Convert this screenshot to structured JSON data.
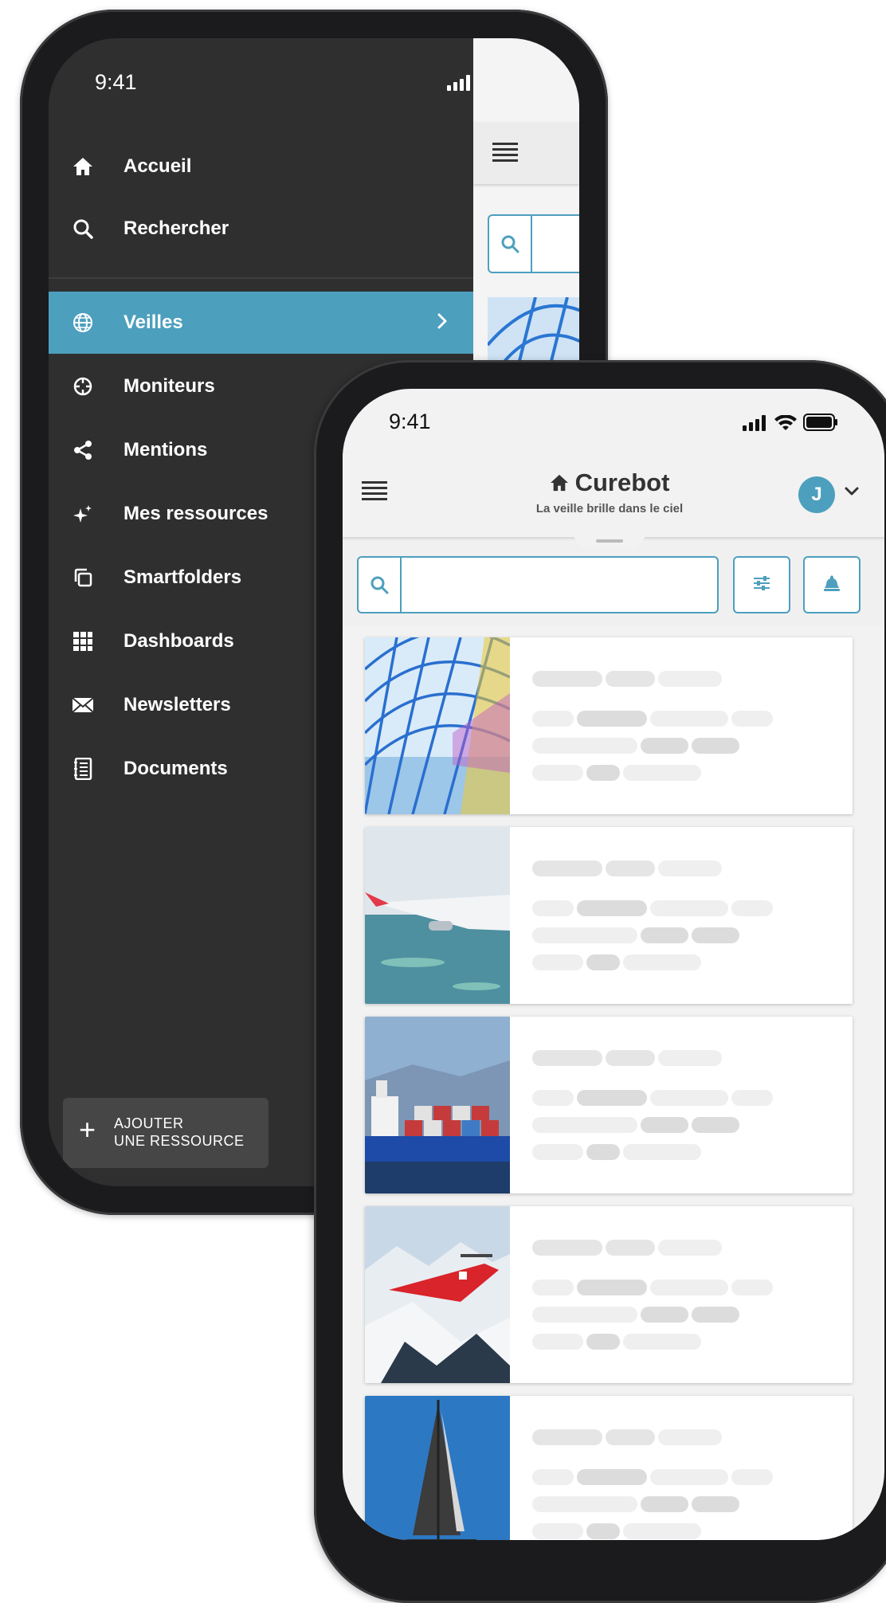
{
  "back_phone": {
    "status_bar": {
      "time": "9:41"
    },
    "menu": {
      "items": [
        {
          "label": "Accueil",
          "icon": "home-icon"
        },
        {
          "label": "Rechercher",
          "icon": "search-icon"
        },
        {
          "label": "Veilles",
          "icon": "globe-icon",
          "active": true
        },
        {
          "label": "Moniteurs",
          "icon": "crosshair-icon"
        },
        {
          "label": "Mentions",
          "icon": "share-icon"
        },
        {
          "label": "Mes ressources",
          "icon": "sparkles-icon"
        },
        {
          "label": "Smartfolders",
          "icon": "copy-icon"
        },
        {
          "label": "Dashboards",
          "icon": "grid-icon"
        },
        {
          "label": "Newsletters",
          "icon": "envelope-icon"
        },
        {
          "label": "Documents",
          "icon": "notebook-icon"
        }
      ],
      "add_resource": {
        "line1": "AJOUTER",
        "line2": "UNE RESSOURCE"
      }
    }
  },
  "front_phone": {
    "status_bar": {
      "time": "9:41"
    },
    "header": {
      "brand": "Curebot",
      "tagline": "La veille brille dans le ciel",
      "avatar_initial": "J"
    },
    "search": {
      "value": "",
      "placeholder": ""
    },
    "cards": [
      {
        "image": "glass-tunnel-train"
      },
      {
        "image": "airplane-wing-ocean"
      },
      {
        "image": "container-ship"
      },
      {
        "image": "rescue-helicopter-mountains"
      },
      {
        "image": "sailboat"
      }
    ]
  },
  "colors": {
    "accent": "#4d9fbe",
    "menu_background": "#2f2f2f",
    "screen_background": "#f2f2f2"
  }
}
